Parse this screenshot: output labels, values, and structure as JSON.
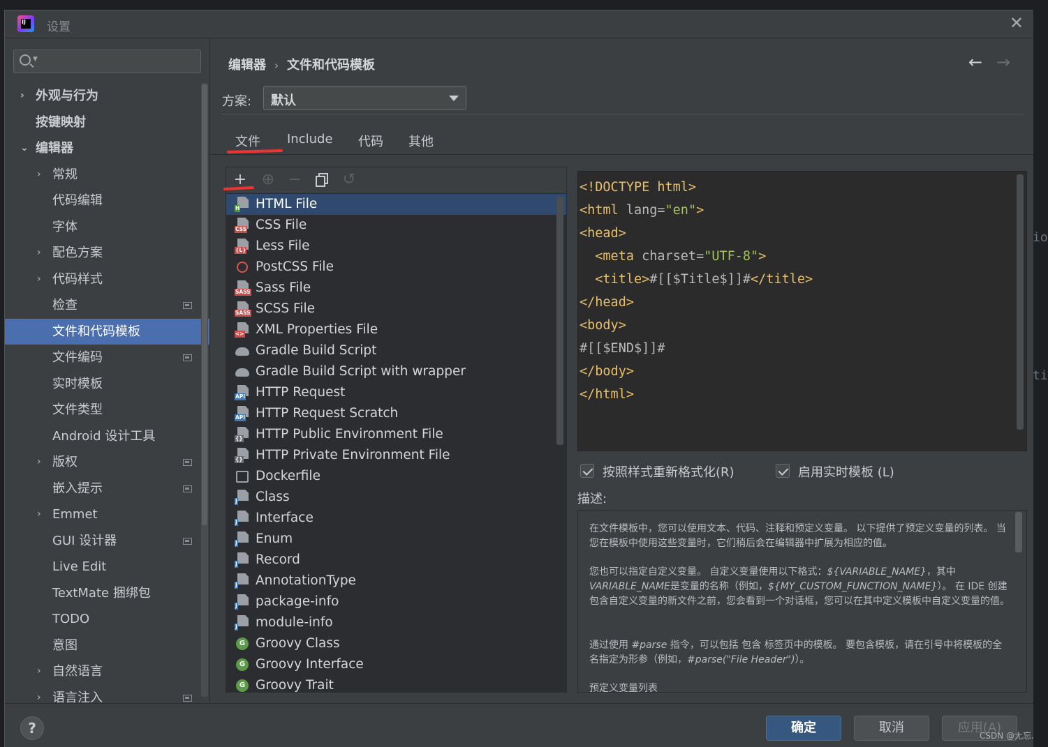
{
  "window": {
    "title": "设置"
  },
  "search": {
    "placeholder": ""
  },
  "sidebar": {
    "items": [
      {
        "label": "外观与行为",
        "bold": true,
        "expander": "›",
        "indent": 0
      },
      {
        "label": "按键映射",
        "bold": true,
        "expander": "",
        "indent": 0
      },
      {
        "label": "编辑器",
        "bold": true,
        "expander": "⌄",
        "indent": 0
      },
      {
        "label": "常规",
        "expander": "›",
        "indent": 1
      },
      {
        "label": "代码编辑",
        "expander": "",
        "indent": 1
      },
      {
        "label": "字体",
        "expander": "",
        "indent": 1
      },
      {
        "label": "配色方案",
        "expander": "›",
        "indent": 1
      },
      {
        "label": "代码样式",
        "expander": "›",
        "indent": 1
      },
      {
        "label": "检查",
        "expander": "",
        "indent": 1,
        "page_icon": true
      },
      {
        "label": "文件和代码模板",
        "expander": "",
        "indent": 1,
        "selected": true
      },
      {
        "label": "文件编码",
        "expander": "",
        "indent": 1,
        "page_icon": true
      },
      {
        "label": "实时模板",
        "expander": "",
        "indent": 1
      },
      {
        "label": "文件类型",
        "expander": "",
        "indent": 1
      },
      {
        "label": "Android 设计工具",
        "expander": "",
        "indent": 1
      },
      {
        "label": "版权",
        "expander": "›",
        "indent": 1,
        "page_icon": true
      },
      {
        "label": "嵌入提示",
        "expander": "",
        "indent": 1,
        "page_icon": true
      },
      {
        "label": "Emmet",
        "expander": "›",
        "indent": 1
      },
      {
        "label": "GUI 设计器",
        "expander": "",
        "indent": 1,
        "page_icon": true
      },
      {
        "label": "Live Edit",
        "expander": "",
        "indent": 1
      },
      {
        "label": "TextMate 捆绑包",
        "expander": "",
        "indent": 1
      },
      {
        "label": "TODO",
        "expander": "",
        "indent": 1
      },
      {
        "label": "意图",
        "expander": "",
        "indent": 1
      },
      {
        "label": "自然语言",
        "expander": "›",
        "indent": 1
      },
      {
        "label": "语言注入",
        "expander": "›",
        "indent": 1,
        "page_icon": true
      }
    ]
  },
  "breadcrumb": {
    "parent": "编辑器",
    "current": "文件和代码模板"
  },
  "scheme": {
    "label": "方案:",
    "value": "默认"
  },
  "tabs": [
    {
      "label": "文件",
      "active": true
    },
    {
      "label": "Include"
    },
    {
      "label": "代码"
    },
    {
      "label": "其他"
    }
  ],
  "toolbar_icons": [
    "add-icon",
    "add-child-icon",
    "remove-icon",
    "copy-icon",
    "reset-icon"
  ],
  "templates": [
    {
      "label": "HTML File",
      "icon": "html",
      "tag": "H",
      "tag_color": "#4b9c35",
      "selected": true
    },
    {
      "label": "CSS File",
      "icon": "css",
      "tag": "CSS",
      "tag_color": "#c94f4f"
    },
    {
      "label": "Less File",
      "icon": "less",
      "tag": "{L}",
      "tag_color": "#c94f4f"
    },
    {
      "label": "PostCSS File",
      "icon": "postcss"
    },
    {
      "label": "Sass File",
      "icon": "sass",
      "tag": "SASS",
      "tag_color": "#c94f4f"
    },
    {
      "label": "SCSS File",
      "icon": "scss",
      "tag": "SASS",
      "tag_color": "#c94f4f"
    },
    {
      "label": "XML Properties File",
      "icon": "xml",
      "tag": "<>",
      "tag_color": "#c94f4f"
    },
    {
      "label": "Gradle Build Script",
      "icon": "gradle"
    },
    {
      "label": "Gradle Build Script with wrapper",
      "icon": "gradle"
    },
    {
      "label": "HTTP Request",
      "icon": "api",
      "tag": "API",
      "tag_color": "#3d7ab8"
    },
    {
      "label": "HTTP Request Scratch",
      "icon": "api",
      "tag": "API",
      "tag_color": "#3d7ab8"
    },
    {
      "label": "HTTP Public Environment File",
      "icon": "env",
      "tag": "{}",
      "tag_color": "#6b6f73"
    },
    {
      "label": "HTTP Private Environment File",
      "icon": "env",
      "tag": "{}",
      "tag_color": "#6b6f73"
    },
    {
      "label": "Dockerfile",
      "icon": "docker"
    },
    {
      "label": "Class",
      "icon": "java",
      "tag": "J",
      "tag_color": "#3d7ab8"
    },
    {
      "label": "Interface",
      "icon": "java",
      "tag": "J",
      "tag_color": "#3d7ab8"
    },
    {
      "label": "Enum",
      "icon": "java",
      "tag": "J",
      "tag_color": "#3d7ab8"
    },
    {
      "label": "Record",
      "icon": "java",
      "tag": "J",
      "tag_color": "#3d7ab8"
    },
    {
      "label": "AnnotationType",
      "icon": "java",
      "tag": "J",
      "tag_color": "#3d7ab8"
    },
    {
      "label": "package-info",
      "icon": "java",
      "tag": "J",
      "tag_color": "#3d7ab8"
    },
    {
      "label": "module-info",
      "icon": "java",
      "tag": "J",
      "tag_color": "#3d7ab8"
    },
    {
      "label": "Groovy Class",
      "icon": "groovy"
    },
    {
      "label": "Groovy Interface",
      "icon": "groovy"
    },
    {
      "label": "Groovy Trait",
      "icon": "groovy"
    }
  ],
  "editor": {
    "lines": [
      [
        [
          "tg",
          "<!DOCTYPE html>"
        ]
      ],
      [
        [
          "tg",
          "<html "
        ],
        [
          "at",
          "lang="
        ],
        [
          "st",
          "\"en\""
        ],
        [
          "tg",
          ">"
        ]
      ],
      [
        [
          "tg",
          "<head>"
        ]
      ],
      [
        [
          "tx",
          "  "
        ],
        [
          "tg",
          "<meta "
        ],
        [
          "at",
          "charset="
        ],
        [
          "st",
          "\"UTF-8\""
        ],
        [
          "tg",
          ">"
        ]
      ],
      [
        [
          "tx",
          "  "
        ],
        [
          "tg",
          "<title>"
        ],
        [
          "tx",
          "#[[$Title$]]#"
        ],
        [
          "tg",
          "</title>"
        ]
      ],
      [
        [
          "tg",
          "</head>"
        ]
      ],
      [
        [
          "tg",
          "<body>"
        ]
      ],
      [
        [
          "tx",
          "#[[$END$]]#"
        ]
      ],
      [
        [
          "tg",
          "</body>"
        ]
      ],
      [
        [
          "tg",
          "</html>"
        ]
      ]
    ]
  },
  "options": {
    "reformat": {
      "label": "按照样式重新格式化(R)",
      "checked": true
    },
    "live_template": {
      "label": "启用实时模板 (L)",
      "checked": true
    }
  },
  "description": {
    "label": "描述:",
    "p1": "在文件模板中，您可以使用文本、代码、注释和预定义变量。 以下提供了预定义变量的列表。 当您在模板中使用这些变量时，它们稍后会在编辑器中扩展为相应的值。",
    "p2_a": "您也可以指定自定义变量。 自定义变量使用以下格式：",
    "p2_var": "${VARIABLE_NAME}",
    "p2_b": "，其中",
    "p2_name": "VARIABLE_NAME",
    "p2_c": "是变量的名称（例如，",
    "p2_ex": "${MY_CUSTOM_FUNCTION_NAME}",
    "p2_d": "）。 在 IDE 创建包含自定义变量的新文件之前，您会看到一个对话框，您可以在其中定义模板中自定义变量的值。",
    "p3_a": "通过使用 ",
    "p3_parse": "#parse",
    "p3_b": " 指令，可以包括 包含 标签页中的模板。 要包含模板，请在引号中将模板的全名指定为形参（例如，",
    "p3_ex": "#parse(\"File Header\")",
    "p3_c": "）。",
    "p4": "预定义变量列表"
  },
  "buttons": {
    "ok": "确定",
    "cancel": "取消",
    "apply": "应用(A)",
    "help": "?"
  },
  "watermark": "CSDN @尢忘.",
  "background_fragments": [
    "io",
    "ti"
  ]
}
